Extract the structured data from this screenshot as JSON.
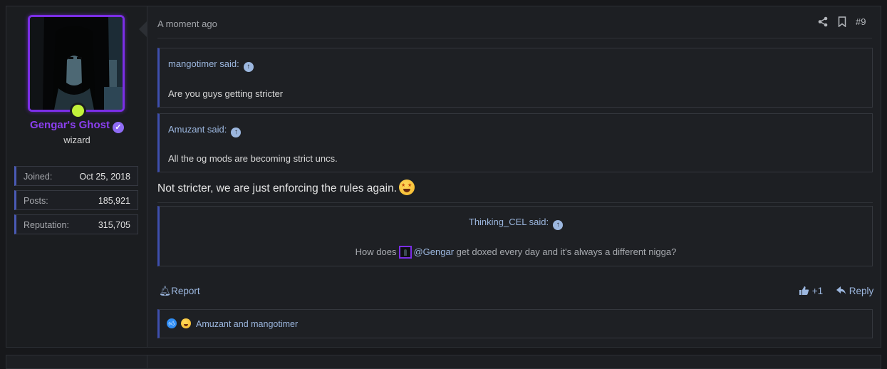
{
  "post": {
    "timestamp": "A moment ago",
    "post_number": "#9",
    "main_text": "Not stricter, we are just enforcing the rules again.",
    "emoji": "star-struck-emoji"
  },
  "user": {
    "name": "Gengar's Ghost",
    "title": "wizard",
    "online": true,
    "stats": [
      {
        "label": "Joined:",
        "value": "Oct 25, 2018"
      },
      {
        "label": "Posts:",
        "value": "185,921"
      },
      {
        "label": "Reputation:",
        "value": "315,705"
      }
    ],
    "accent_color": "#8b3ff0",
    "online_color": "#c2f23a"
  },
  "quotes": [
    {
      "author": "mangotimer said:",
      "text": "Are you guys getting stricter"
    },
    {
      "author": "Amuzant said:",
      "text": "All the og mods are becoming strict uncs."
    }
  ],
  "quote3": {
    "author": "Thinking_CEL said:",
    "text_before": "How does",
    "mention": "@Gengar",
    "text_after": "get doxed every day and it's always a different nigga?"
  },
  "actions": {
    "report": "Report",
    "like_count": "+1",
    "reply": "Reply"
  },
  "reactions": {
    "names": "Amuzant and mangotimer",
    "icons": [
      "like-reaction-icon",
      "haha-reaction-icon"
    ]
  },
  "icons": {
    "share": "share-icon",
    "bookmark": "bookmark-icon",
    "report": "bell-icon",
    "like": "thumbs-up-icon",
    "reply": "reply-arrow-icon",
    "quote_jump": "arrow-up-circle-icon"
  }
}
